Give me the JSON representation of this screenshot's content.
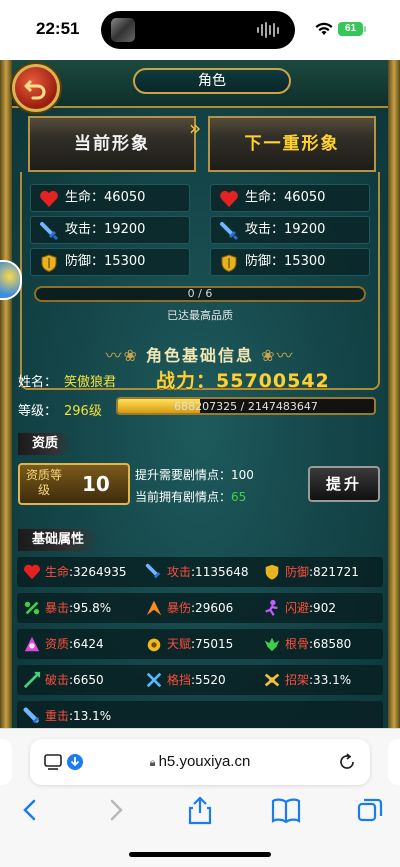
{
  "status_bar": {
    "time": "22:51",
    "battery": "61"
  },
  "header": {
    "title": "角色"
  },
  "portraits": {
    "current": "当前形象",
    "next": "下一重形象"
  },
  "current_stats": [
    {
      "icon": "heart-icon",
      "label": "生命",
      "value": "46050"
    },
    {
      "icon": "sword-icon",
      "label": "攻击",
      "value": "19200"
    },
    {
      "icon": "shield-icon",
      "label": "防御",
      "value": "15300"
    }
  ],
  "next_stats": [
    {
      "icon": "heart-icon",
      "label": "生命",
      "value": "46050"
    },
    {
      "icon": "sword-icon",
      "label": "攻击",
      "value": "19200"
    },
    {
      "icon": "shield-icon",
      "label": "防御",
      "value": "15300"
    }
  ],
  "quality": {
    "progress_text": "0 / 6",
    "progress_fraction": 0,
    "status": "已达最高品质"
  },
  "basic_info": {
    "title": "角色基础信息",
    "name_label": "姓名：",
    "name_value": "笑傲狼君",
    "power_label": "战力：",
    "power_value": "55700542",
    "level_label": "等级：",
    "level_value": "296级",
    "exp_text": "688207325 / 2147483647",
    "exp_fraction": 0.32
  },
  "aptitude": {
    "section_label": "资质",
    "box_label": "资质等级",
    "value": "10",
    "need_text": "提升需要剧情点：100",
    "have_label": "当前拥有剧情点：",
    "have_value": "65",
    "upgrade_button": "提升"
  },
  "attributes": {
    "section_label": "基础属性",
    "rows": [
      [
        {
          "icon": "heart-icon",
          "label": "生命",
          "value": ":3264935",
          "color": "#ff3b30"
        },
        {
          "icon": "sword-icon",
          "label": "攻击",
          "value": ":1135648",
          "color": "#ff3b30"
        },
        {
          "icon": "shield-icon",
          "label": "防御",
          "value": ":821721",
          "color": "#ff3b30"
        }
      ],
      [
        {
          "icon": "crit-icon",
          "label": "暴击",
          "value": ":95.8%",
          "color": "#ff3b30"
        },
        {
          "icon": "crit-damage-icon",
          "label": "暴伤",
          "value": ":29606",
          "color": "#ff3b30"
        },
        {
          "icon": "dodge-icon",
          "label": "闪避",
          "value": ":902",
          "color": "#ff3b30"
        }
      ],
      [
        {
          "icon": "aptitude-icon",
          "label": "资质",
          "value": ":6424",
          "color": "#ff3b30"
        },
        {
          "icon": "talent-icon",
          "label": "天赋",
          "value": ":75015",
          "color": "#ff3b30"
        },
        {
          "icon": "bone-icon",
          "label": "根骨",
          "value": ":68580",
          "color": "#ff3b30"
        }
      ],
      [
        {
          "icon": "pierce-icon",
          "label": "破击",
          "value": ":6650",
          "color": "#ff3b30"
        },
        {
          "icon": "block-icon",
          "label": "格挡",
          "value": ":5520",
          "color": "#ff3b30"
        },
        {
          "icon": "parry-icon",
          "label": "招架",
          "value": ":33.1%",
          "color": "#ff3b30"
        }
      ],
      [
        {
          "icon": "heavy-hit-icon",
          "label": "重击",
          "value": ":13.1%",
          "color": "#ff3b30"
        }
      ]
    ]
  },
  "browser": {
    "url": "h5.youxiya.cn"
  }
}
